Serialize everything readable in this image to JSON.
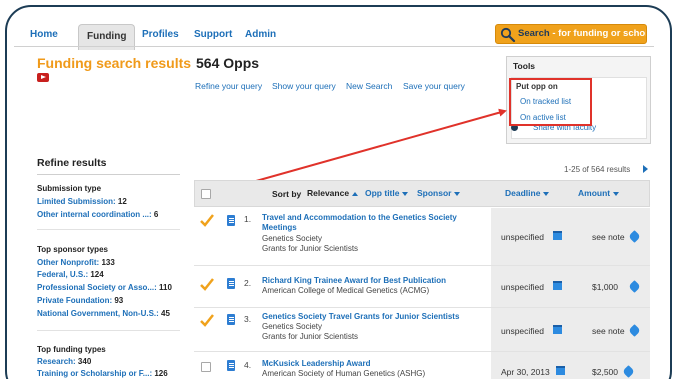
{
  "nav": {
    "tabs": [
      {
        "label": "Home"
      },
      {
        "label": "Funding"
      },
      {
        "label": "Profiles"
      },
      {
        "label": "Support"
      },
      {
        "label": "Admin"
      }
    ],
    "active_tab": "Funding",
    "search_label": "Search",
    "search_suffix": "- for funding or scholars"
  },
  "page": {
    "title": "Funding search results",
    "opps_count": "564 Opps",
    "query_links": [
      "Refine your query",
      "Show your query",
      "New Search",
      "Save your query"
    ]
  },
  "tools": {
    "title": "Tools",
    "put_opp_on": "Put opp on",
    "tracked": "On tracked list",
    "active": "On active list",
    "share": "Share with faculty"
  },
  "sidebar": {
    "title": "Refine results",
    "groups": [
      {
        "heading": "Submission type",
        "items": [
          {
            "label": "Limited Submission:",
            "count": "12"
          },
          {
            "label": "Other internal coordination ...:",
            "count": "6"
          }
        ]
      },
      {
        "heading": "Top sponsor types",
        "items": [
          {
            "label": "Other Nonprofit:",
            "count": "133"
          },
          {
            "label": "Federal, U.S.:",
            "count": "124"
          },
          {
            "label": "Professional Society or Asso...:",
            "count": "110"
          },
          {
            "label": "Private Foundation:",
            "count": "93"
          },
          {
            "label": "National Government, Non-U.S.:",
            "count": "45"
          }
        ]
      },
      {
        "heading": "Top funding types",
        "items": [
          {
            "label": "Research:",
            "count": "340"
          },
          {
            "label": "Training or Scholarship or F...:",
            "count": "126"
          }
        ]
      }
    ]
  },
  "results": {
    "range": "1-25 of 564 results",
    "header": {
      "sort_by": "Sort by",
      "relevance": "Relevance",
      "opp_title": "Opp title",
      "sponsor": "Sponsor",
      "deadline": "Deadline",
      "amount": "Amount"
    },
    "rows": [
      {
        "num": "1.",
        "title": "Travel and Accommodation to the Genetics Society Meetings",
        "sponsor": "Genetics Society",
        "program": "Grants for Junior Scientists",
        "deadline": "unspecified",
        "amount": "see note",
        "tracked": true
      },
      {
        "num": "2.",
        "title": "Richard King Trainee Award for Best Publication",
        "sponsor": "American College of Medical Genetics (ACMG)",
        "program": "",
        "deadline": "unspecified",
        "amount": "$1,000",
        "tracked": true
      },
      {
        "num": "3.",
        "title": "Genetics Society Travel Grants for Junior Scientists",
        "sponsor": "Genetics Society",
        "program": "Grants for Junior Scientists",
        "deadline": "unspecified",
        "amount": "see note",
        "tracked": true
      },
      {
        "num": "4.",
        "title": "McKusick Leadership Award",
        "sponsor": "American Society of Human Genetics (ASHG)",
        "program": "",
        "deadline": "Apr 30, 2013",
        "amount": "$2,500",
        "tracked": false
      }
    ]
  },
  "colors": {
    "accent_orange": "#f09a1a",
    "link_blue": "#1d6fb8",
    "highlight_red": "#e0322a",
    "frame_navy": "#1c3c55"
  }
}
